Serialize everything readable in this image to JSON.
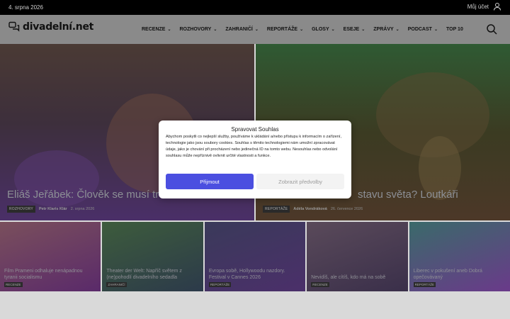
{
  "topbar": {
    "date": "4. srpna 2026",
    "account_label": "Můj účet"
  },
  "header": {
    "logo_text": "divadelní.net",
    "nav": [
      {
        "label": "RECENZE",
        "chevron": true
      },
      {
        "label": "ROZHOVORY",
        "chevron": true
      },
      {
        "label": "ZAHRANIČÍ",
        "chevron": true
      },
      {
        "label": "REPORTÁŽE",
        "chevron": true
      },
      {
        "label": "GLOSY",
        "chevron": true
      },
      {
        "label": "ESEJE",
        "chevron": true
      },
      {
        "label": "ZPRÁVY",
        "chevron": true
      },
      {
        "label": "PODCAST",
        "chevron": true
      },
      {
        "label": "TOP 10",
        "chevron": false
      }
    ]
  },
  "hero": [
    {
      "title": "Eliáš Jeřábek: Člověk se musí trošku",
      "category": "ROZHOVORY",
      "author": "Petr Klaris Klár",
      "date": "2. srpna 2026"
    },
    {
      "title": "stavu světa? Loutkáři",
      "category": "REPORTÁŽE",
      "author": "Adéla Vondráková",
      "date": "26. července 2026"
    }
  ],
  "cards": [
    {
      "title": "Film Prameni odhaluje nenápadnou tyranii socialismu",
      "category": "RECENZE",
      "colors": [
        "#7a4f5c",
        "#5a2a6a"
      ]
    },
    {
      "title": "Theater der Welt: Napříč světem z (ne)pohodlí divadelního sedadla",
      "category": "ZAHRANIČÍ",
      "colors": [
        "#3d5c3c",
        "#2c3a4a"
      ]
    },
    {
      "title": "Evropa sobě, Hollywoodu nazdory. Festival v Cannes 2026",
      "category": "REPORTÁŽE",
      "colors": [
        "#3a3a5a",
        "#4b2f6a"
      ]
    },
    {
      "title": "Nevidíš, ale cítíš, kdo má na sobě",
      "category": "RECENZE",
      "colors": [
        "#5a4a5a",
        "#3a2f4a"
      ]
    },
    {
      "title": "Liberec v pokušení aneb Dobrá opečovávaný",
      "category": "REPORTÁŽE",
      "colors": [
        "#3a6a6a",
        "#6a3a8a"
      ]
    }
  ],
  "consent": {
    "title": "Spravovat Souhlas",
    "text": "Abychom poskytli co nejlepší služby, používáme k ukládání a/nebo přístupu k informacím o zařízení, technologie jako jsou soubory cookies. Souhlas s těmito technologiemi nám umožní zpracovávat údaje, jako je chování při procházení nebo jedinečná ID na tomto webu. Nesouhlas nebo odvolání souhlasu může nepříznivě ovlivnit určité vlastnosti a funkce.",
    "accept_label": "Přijmout",
    "prefs_label": "Zobrazit předvolby",
    "accent": "#4b4fe0"
  }
}
